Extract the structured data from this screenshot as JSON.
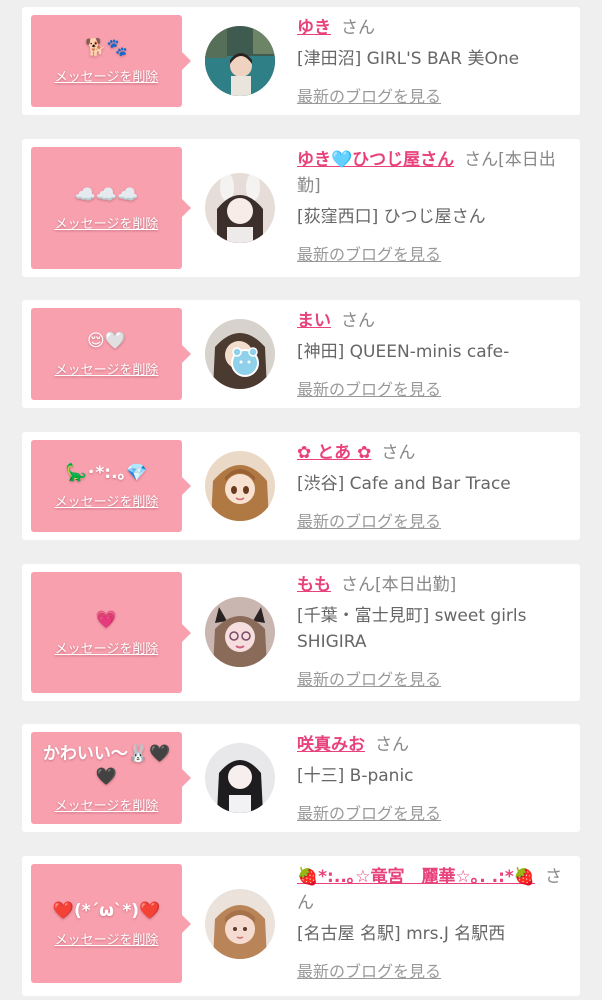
{
  "common": {
    "delete_label": "メッセージを削除",
    "honorific": "さん",
    "blog_label": "最新のブログを見る"
  },
  "colors": {
    "page_bg": "#efefef",
    "card_bg": "#ffffff",
    "bubble_bg": "#f8a0ae",
    "name_color": "#e8427c",
    "sub_text": "#888888"
  },
  "messages": [
    {
      "message": "🐕🐾",
      "name": "ゆき",
      "status": "",
      "shop": "[津田沼] GIRL'S BAR 美One",
      "avatar_icon": "profile-photo-poolside"
    },
    {
      "message": "☁️☁️☁️",
      "name": "ゆき🩵ひつじ屋さん",
      "status": "[本日出勤]",
      "shop": "[荻窪西口] ひつじ屋さん",
      "avatar_icon": "profile-photo-bunny-ears"
    },
    {
      "message": "😌🤍",
      "name": "まい",
      "status": "",
      "shop": "[神田] QUEEN-minis cafe-",
      "avatar_icon": "profile-photo-bear-sticker"
    },
    {
      "message": "🦕･*:.｡💎",
      "name": "✿ とあ ✿",
      "status": "",
      "shop": "[渋谷] Cafe and Bar Trace",
      "avatar_icon": "profile-illustration-anime"
    },
    {
      "message": "💗",
      "name": "もも",
      "status": "[本日出勤]",
      "shop": "[千葉・富士見町] sweet girls SHIGIRA",
      "avatar_icon": "profile-photo-cat-ears"
    },
    {
      "message": "かわいい〜🐰🖤🖤",
      "name": "咲真みお",
      "status": "",
      "shop": "[十三] B-panic",
      "avatar_icon": "profile-photo-dark-hair"
    },
    {
      "message": "❤️(*´ω`*)❤️",
      "name": "🍓*:..｡☆竜宮　麗華☆｡. .:*🍓",
      "status": "",
      "shop": "[名古屋 名駅] mrs.J 名駅西",
      "avatar_icon": "profile-photo-bangs"
    }
  ]
}
